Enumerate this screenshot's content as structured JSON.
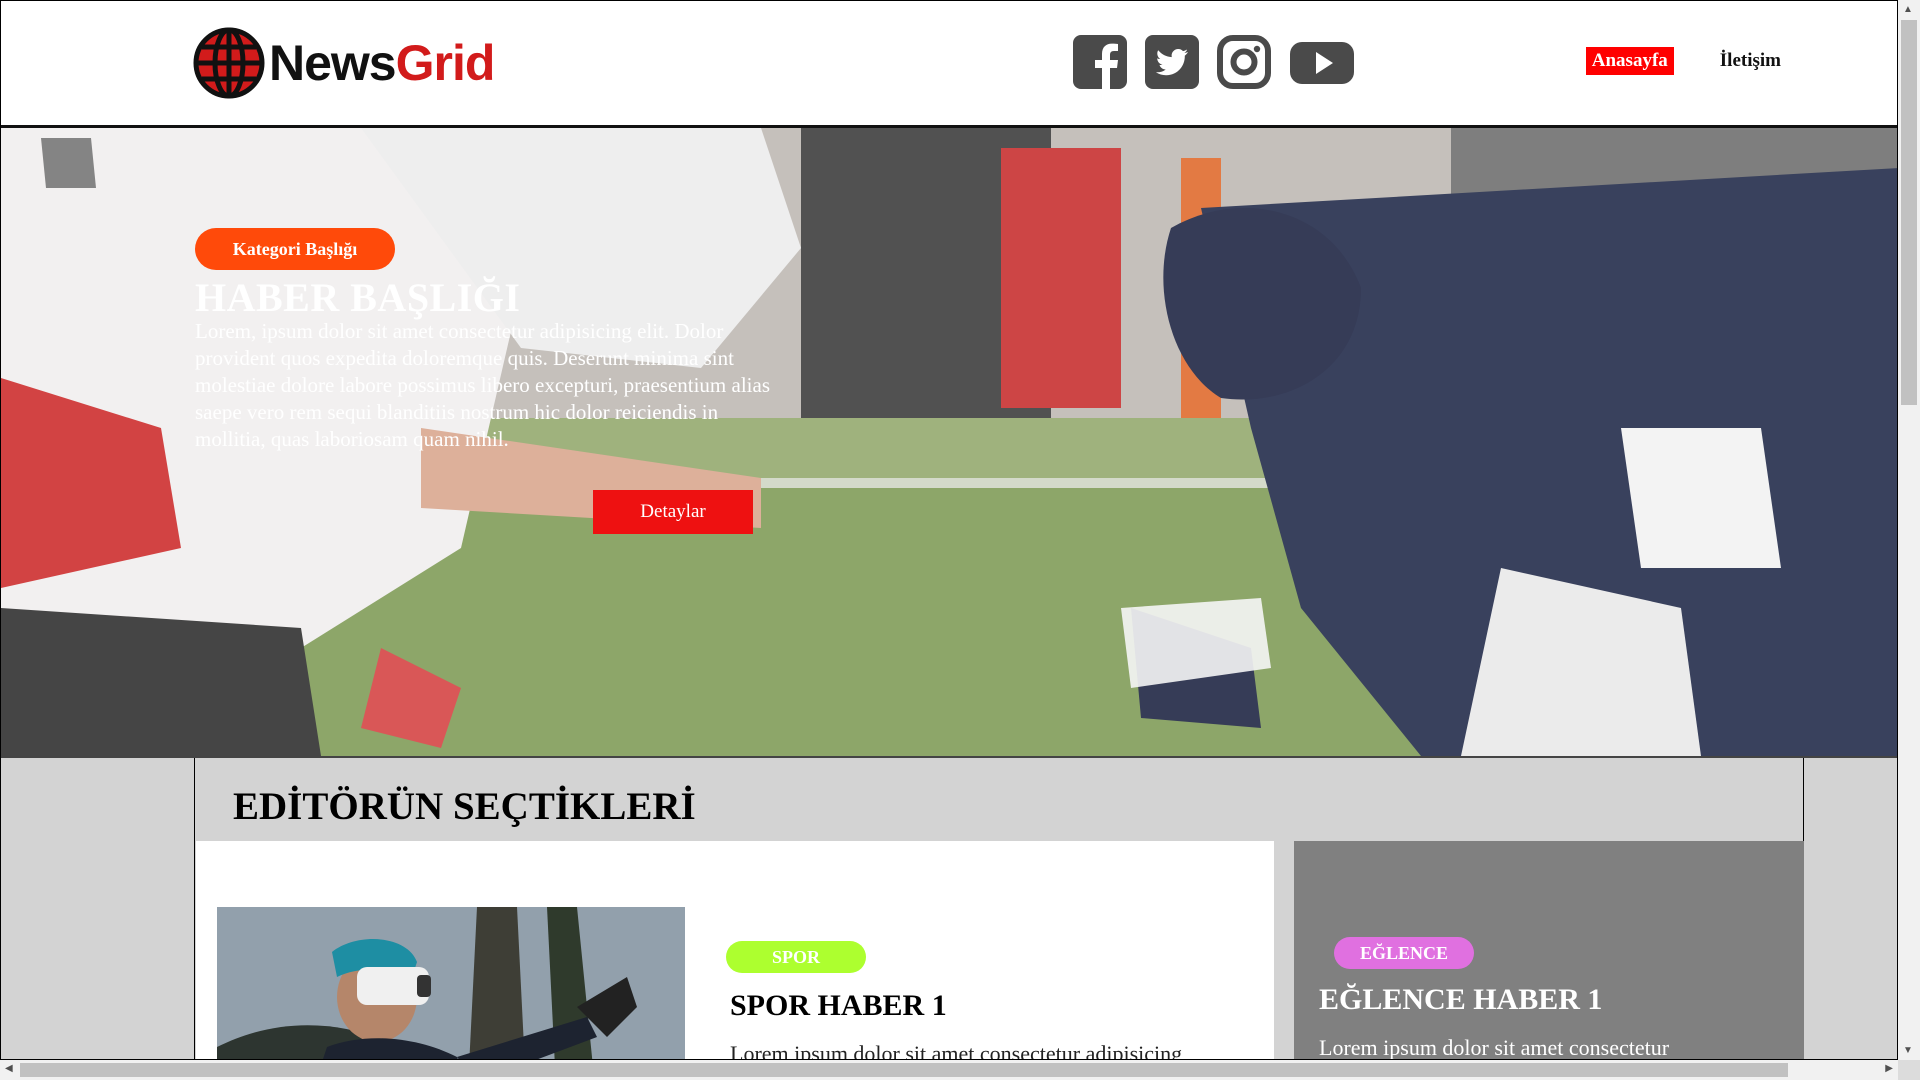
{
  "header": {
    "logo": {
      "part1": "News",
      "part2": "Grid",
      "icon": "globe-icon"
    },
    "socials": [
      {
        "icon": "facebook-icon"
      },
      {
        "icon": "twitter-icon"
      },
      {
        "icon": "instagram-icon"
      },
      {
        "icon": "youtube-icon"
      }
    ],
    "nav": {
      "home": "Anasayfa",
      "contact": "İletişim"
    }
  },
  "hero": {
    "category": "Kategori Başlığı",
    "title": "HABER BAŞLIĞI",
    "text": "Lorem, ipsum dolor sit amet consectetur adipisicing elit. Dolor provident quos expedita doloremque quis. Deserunt minima sint molestiae dolore labore possimus libero excepturi, praesentium alias saepe vero rem sequi blanditiis nostrum hic dolor reiciendis in mollitia, quas laboriosam quam nihil.",
    "button": "Detaylar",
    "image": "american-football-line-of-scrimmage-photo"
  },
  "editor_picks": {
    "title": "EDİTÖRÜN SEÇTİKLERİ",
    "main_card": {
      "tag": "SPOR",
      "title": "SPOR HABER 1",
      "text": "Lorem ipsum dolor sit amet consectetur adipisicing",
      "image": "vr-headset-man-photo"
    },
    "side_card": {
      "tag": "EĞLENCE",
      "title": "EĞLENCE HABER 1",
      "text": "Lorem ipsum dolor sit amet consectetur"
    }
  },
  "colors": {
    "brand_red": "#d21b1b",
    "nav_active": "#ff0000",
    "category_badge": "#ff4a0a",
    "details_button": "#ee1111",
    "sport_tag": "#adff2f",
    "fun_tag": "#e070e0",
    "side_card": "#808080",
    "section_bg": "#d3d3d3"
  }
}
